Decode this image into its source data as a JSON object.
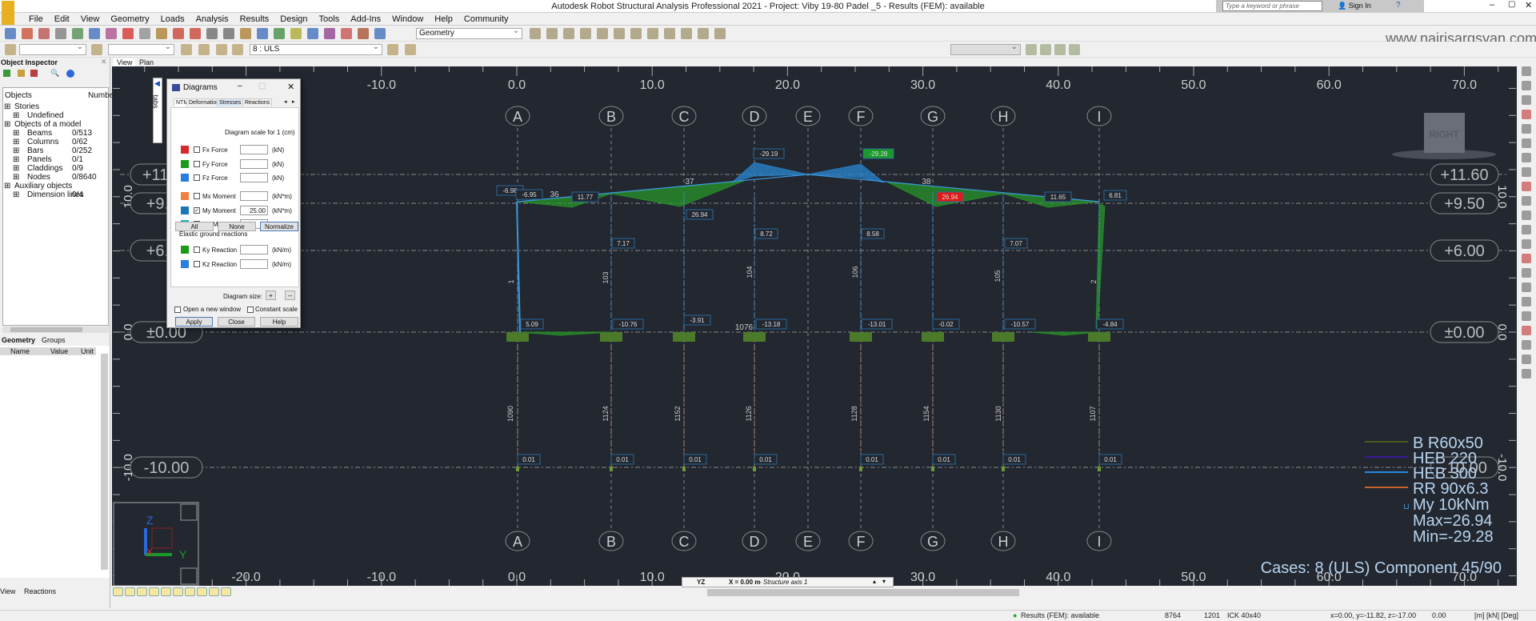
{
  "window": {
    "title": "Autodesk Robot Structural Analysis Professional 2021 - Project: Viby 19-80 Padel _5 - Results (FEM): available",
    "search_placeholder": "Type a keyword or phrase",
    "sign_in": "Sign In",
    "watermark": "www.nairisargsyan.com"
  },
  "menu": [
    "File",
    "Edit",
    "View",
    "Geometry",
    "Loads",
    "Analysis",
    "Results",
    "Design",
    "Tools",
    "Add-Ins",
    "Window",
    "Help",
    "Community"
  ],
  "toolbar": {
    "view_select": "Geometry",
    "load_case_select": "8 : ULS"
  },
  "inspector": {
    "title": "Object Inspector",
    "col_objects": "Objects",
    "col_number": "Numbe",
    "tree": [
      {
        "label": "Stories",
        "count": ""
      },
      {
        "label": "Undefined",
        "count": ""
      },
      {
        "label": "Objects of a model",
        "count": ""
      },
      {
        "label": "Beams",
        "count": "0/513"
      },
      {
        "label": "Columns",
        "count": "0/62"
      },
      {
        "label": "Bars",
        "count": "0/252"
      },
      {
        "label": "Panels",
        "count": "0/1"
      },
      {
        "label": "Claddings",
        "count": "0/9"
      },
      {
        "label": "Nodes",
        "count": "0/8640"
      },
      {
        "label": "Auxiliary objects",
        "count": ""
      },
      {
        "label": "Dimension lines",
        "count": "0/4"
      }
    ],
    "tabs": [
      "Geometry",
      "Groups"
    ],
    "prop_cols": [
      "Name",
      "Value",
      "Unit"
    ],
    "bottom_tabs": [
      "View",
      "Reactions"
    ]
  },
  "view_tabs": [
    "View",
    "Plan"
  ],
  "side_tab": "tabs",
  "dialog": {
    "title": "Diagrams",
    "tabs": [
      "NTM",
      "Deformation",
      "Stresses",
      "Reactions"
    ],
    "scale_label": "Diagram scale for 1  (cm)",
    "rows": [
      {
        "label": "Fx Force",
        "unit": "(kN)",
        "value": "",
        "checked": false,
        "color": "#d42a2a"
      },
      {
        "label": "Fy Force",
        "unit": "(kN)",
        "value": "",
        "checked": false,
        "color": "#1a9a1a"
      },
      {
        "label": "Fz Force",
        "unit": "(kN)",
        "value": "",
        "checked": false,
        "color": "#2b7de0"
      },
      {
        "label": "Mx Moment",
        "unit": "(kN*m)",
        "value": "",
        "checked": false,
        "color": "#f08040"
      },
      {
        "label": "My Moment",
        "unit": "(kN*m)",
        "value": "25.00",
        "checked": true,
        "color": "#1a78b8"
      },
      {
        "label": "Mz Moment",
        "unit": "(kN*m)",
        "value": "",
        "checked": false,
        "color": "#20b0b8"
      },
      {
        "label": "Ky Reaction",
        "unit": "(kN/m)",
        "value": "",
        "checked": false,
        "color": "#1a9a1a"
      },
      {
        "label": "Kz Reaction",
        "unit": "(kN/m)",
        "value": "",
        "checked": false,
        "color": "#2b7de0"
      }
    ],
    "elastic_label": "Elastic ground reactions",
    "btn_all": "All",
    "btn_none": "None",
    "btn_normalize": "Normalize",
    "size_label": "Diagram size:",
    "size_plus": "+",
    "size_minus": "--",
    "open_new": "Open a new window",
    "constant_scale": "Constant scale",
    "apply": "Apply",
    "close": "Close",
    "help": "Help"
  },
  "grid": {
    "columns": [
      "A",
      "B",
      "C",
      "D",
      "E",
      "F",
      "G",
      "H",
      "I"
    ],
    "levels": [
      "+11.60",
      "+9.50",
      "+6.00",
      "±0.00",
      "-10.00"
    ],
    "top_ruler": [
      "-10.0",
      "0.0",
      "10.0",
      "20.0",
      "30.0",
      "40.0",
      "50.0",
      "60.0",
      "70.0"
    ],
    "bottom_ruler": [
      "-20.0",
      "-10.0",
      "0.0",
      "10.0",
      "20.0",
      "30.0",
      "40.0",
      "50.0",
      "60.0",
      "70.0"
    ],
    "vert_ruler": [
      "10.0",
      "0.0",
      "-10.0"
    ]
  },
  "diagram": {
    "value_labels": [
      "-6.98",
      "-6.95",
      "11.77",
      "26.94",
      "-29.19",
      "8.72",
      "7.17",
      "5.09",
      "-10.76",
      "-3.91",
      "-13.18",
      "-29.28",
      "8.58",
      "26.94",
      "11.65",
      "6.81",
      "7.07",
      "-13.01",
      "-0.02",
      "-10.57",
      "-4.84",
      "0.01",
      "0.01",
      "0.01",
      "0.01",
      "0.01",
      "0.01",
      "0.01",
      "0.01"
    ],
    "max_label_index": 13,
    "min_label_index": 11,
    "member_labels": [
      "36",
      "37",
      "38",
      "1",
      "103",
      "104",
      "106",
      "105",
      "2",
      "1076",
      "1090",
      "1124",
      "1152",
      "1126",
      "1128",
      "1154",
      "1130",
      "1107"
    ]
  },
  "legend": {
    "items": [
      {
        "label": "B R60x50",
        "color": "#4a5a1e"
      },
      {
        "label": "HEB 220",
        "color": "#3a1a9a"
      },
      {
        "label": "HEB 300",
        "color": "#2a8ae0"
      },
      {
        "label": "RR 90x6.3",
        "color": "#c8642a"
      }
    ],
    "quantity": "My  10kNm",
    "max": "Max=26.94",
    "min": "Min=-29.28",
    "cases": "Cases: 8 (ULS) Component 45/90"
  },
  "view_cube": "RIGHT",
  "section_bar": {
    "plane": "YZ",
    "position": "X = 0.00 m",
    "axis": " - Structure axis 1"
  },
  "status": {
    "results": "Results (FEM): available",
    "nodes": "8764",
    "bars": "1201",
    "section": "ICK 40x40",
    "coords": "x=0.00, y=-11.82, z=-17.00",
    "angle": "0.00",
    "units": "[m] [kN] [Deg]"
  }
}
